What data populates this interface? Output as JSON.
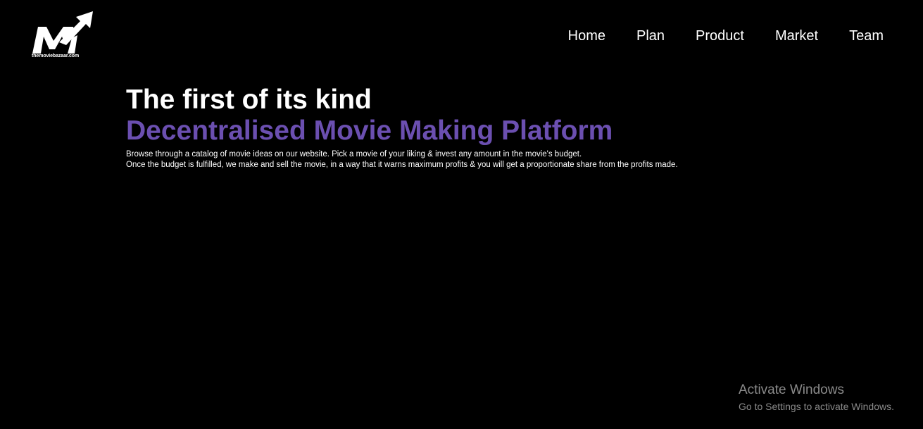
{
  "brand": {
    "logo_caption": "themoviebazaar.com",
    "logo_icon": "m-arrow-logo-icon"
  },
  "nav": {
    "items": [
      {
        "label": "Home"
      },
      {
        "label": "Plan"
      },
      {
        "label": "Product"
      },
      {
        "label": "Market"
      },
      {
        "label": "Team"
      }
    ]
  },
  "hero": {
    "title": "The first of its kind",
    "subtitle": "Decentralised Movie Making Platform",
    "description_line1": "Browse through a catalog of movie ideas on our website. Pick a movie of your liking & invest any amount in the movie's budget.",
    "description_line2": "Once the budget is fulfilled, we make and sell the movie, in a way that it warns maximum profits & you will get a proportionate share from the profits made."
  },
  "watermark": {
    "title": "Activate Windows",
    "subtitle": "Go to Settings to activate Windows."
  },
  "colors": {
    "background": "#000000",
    "text": "#ffffff",
    "accent": "#6b4fb0",
    "watermark": "#8a8a8a"
  }
}
